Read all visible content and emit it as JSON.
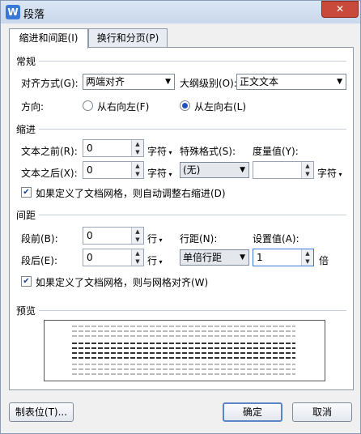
{
  "window": {
    "title": "段落",
    "app_icon": "W",
    "close_label": "✕"
  },
  "tabs": [
    {
      "label": "缩进和间距(I)"
    },
    {
      "label": "换行和分页(P)"
    }
  ],
  "general": {
    "heading": "常规",
    "align_label": "对齐方式(G):",
    "align_value": "两端对齐",
    "outline_label": "大纲级别(O):",
    "outline_value": "正文文本",
    "direction_label": "方向:",
    "rtl_label": "从右向左(F)",
    "ltr_label": "从左向右(L)",
    "direction_selected": "ltr"
  },
  "indent": {
    "heading": "缩进",
    "before_label": "文本之前(R):",
    "before_value": "0",
    "before_unit": "字符",
    "after_label": "文本之后(X):",
    "after_value": "0",
    "after_unit": "字符",
    "special_label": "特殊格式(S):",
    "special_value": "(无)",
    "measure_label": "度量值(Y):",
    "measure_value": "",
    "measure_unit": "字符",
    "auto_adjust_label": "如果定义了文档网格，则自动调整右缩进(D)",
    "auto_adjust_checked": true
  },
  "spacing": {
    "heading": "间距",
    "before_label": "段前(B):",
    "before_value": "0",
    "before_unit": "行",
    "after_label": "段后(E):",
    "after_value": "0",
    "after_unit": "行",
    "line_label": "行距(N):",
    "line_value": "单倍行距",
    "setting_label": "设置值(A):",
    "setting_value": "1",
    "setting_unit": "倍",
    "snap_label": "如果定义了文档网格，则与网格对齐(W)",
    "snap_checked": true
  },
  "preview": {
    "heading": "预览"
  },
  "buttons": {
    "tabs_label": "制表位(T)...",
    "ok_label": "确定",
    "cancel_label": "取消"
  },
  "icons": {
    "app": "wps-writer-icon",
    "close": "close-icon",
    "dropdown": "chevron-down-icon",
    "spin_up": "spin-up-icon",
    "spin_down": "spin-down-icon"
  }
}
